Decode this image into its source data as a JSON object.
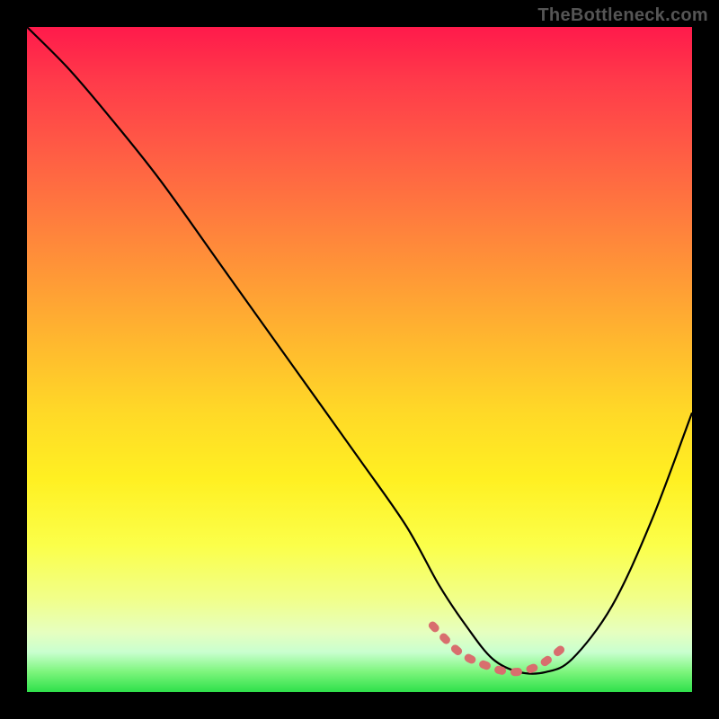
{
  "watermark": "TheBottleneck.com",
  "chart_data": {
    "type": "line",
    "title": "",
    "xlabel": "",
    "ylabel": "",
    "xlim": [
      0,
      100
    ],
    "ylim": [
      0,
      100
    ],
    "grid": false,
    "series": [
      {
        "name": "curve",
        "color": "#000000",
        "x": [
          0,
          6,
          12,
          20,
          30,
          40,
          50,
          57,
          62,
          66,
          70,
          74,
          78,
          82,
          88,
          94,
          100
        ],
        "values": [
          100,
          94,
          87,
          77,
          63,
          49,
          35,
          25,
          16,
          10,
          5,
          3,
          3,
          5,
          13,
          26,
          42
        ]
      },
      {
        "name": "min-highlight",
        "color": "#d26a6a",
        "x": [
          61,
          65,
          69,
          73,
          77,
          81
        ],
        "values": [
          10,
          6,
          4,
          3,
          4,
          7
        ]
      }
    ],
    "gradient_stops": [
      {
        "pos": 0,
        "color": "#ff1a4b"
      },
      {
        "pos": 28,
        "color": "#ff7a3e"
      },
      {
        "pos": 58,
        "color": "#ffd927"
      },
      {
        "pos": 86,
        "color": "#f1ff8a"
      },
      {
        "pos": 97,
        "color": "#7cf57c"
      },
      {
        "pos": 100,
        "color": "#2ee04a"
      }
    ]
  }
}
